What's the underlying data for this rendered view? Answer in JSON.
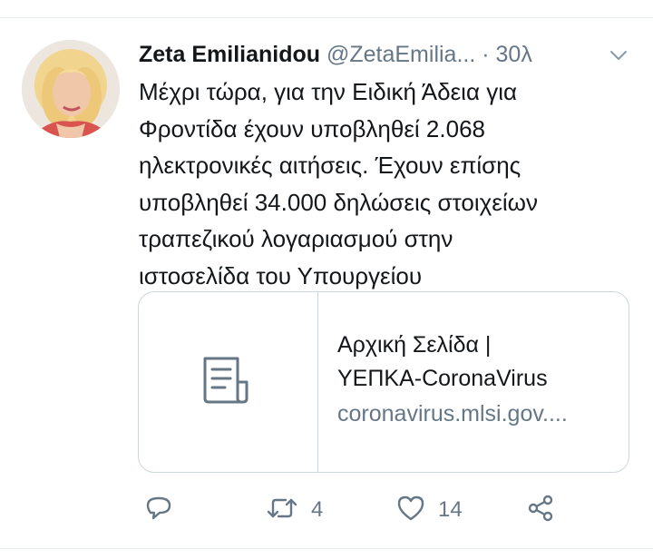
{
  "tweet": {
    "author_name": "Zeta Emilianidou",
    "author_handle": "@ZetaEmilia...",
    "separator": "·",
    "timestamp": "30λ",
    "text_lines": [
      "Μέχρι τώρα, για την Ειδική Άδεια για",
      "Φροντίδα έχουν υποβληθεί 2.068",
      "ηλεκτρονικές αιτήσεις. Έχουν επίσης",
      "υποβληθεί 34.000 δηλώσεις στοιχείων",
      "τραπεζικού λογαριασμού στην",
      "ιστοσελίδα του Υπουργείου"
    ]
  },
  "card": {
    "title_lines": [
      "Αρχική Σελίδα |",
      "ΥΕΠΚΑ-CoronaVirus"
    ],
    "domain": "coronavirus.mlsi.gov....",
    "thumb_icon": "document-icon"
  },
  "actions": {
    "reply_icon": "reply-icon",
    "retweet_icon": "retweet-icon",
    "retweet_count": "4",
    "like_icon": "heart-icon",
    "like_count": "14",
    "share_icon": "share-icon"
  },
  "colors": {
    "text_primary": "#14171a",
    "text_secondary": "#657786",
    "border": "#ccd6dd"
  }
}
